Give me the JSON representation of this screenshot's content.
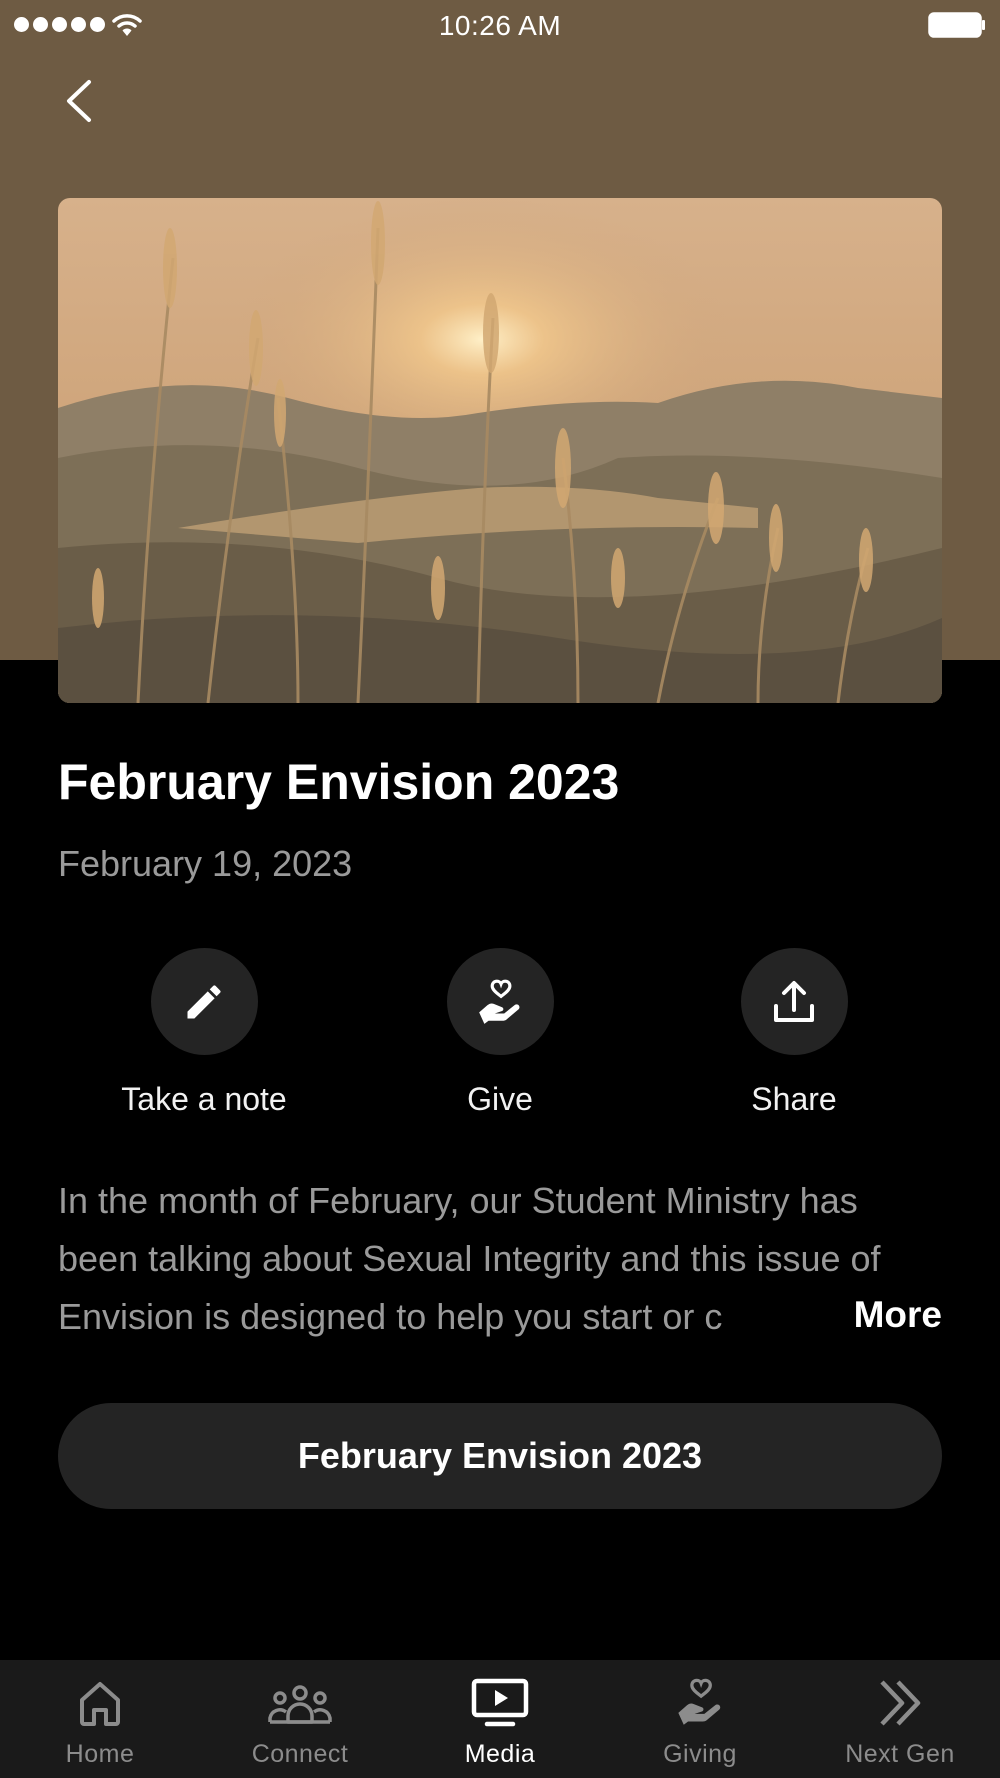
{
  "status_bar": {
    "time": "10:26 AM"
  },
  "content": {
    "title": "February Envision 2023",
    "date": "February 19, 2023",
    "description": "In the month of February, our Student Ministry has been talking about Sexual Integrity and this issue of Envision is designed to help you start or c",
    "more_label": "More",
    "primary_button_label": "February Envision 2023"
  },
  "actions": [
    {
      "label": "Take a note",
      "icon": "pencil-icon"
    },
    {
      "label": "Give",
      "icon": "hand-heart-icon"
    },
    {
      "label": "Share",
      "icon": "share-icon"
    }
  ],
  "tabs": [
    {
      "label": "Home",
      "icon": "home-icon",
      "active": false
    },
    {
      "label": "Connect",
      "icon": "group-icon",
      "active": false
    },
    {
      "label": "Media",
      "icon": "play-screen-icon",
      "active": true
    },
    {
      "label": "Giving",
      "icon": "hand-heart-icon",
      "active": false
    },
    {
      "label": "Next Gen",
      "icon": "double-chevron-icon",
      "active": false
    }
  ],
  "colors": {
    "hero_background": "#6e5b43",
    "page_background": "#000000",
    "surface": "#242424",
    "tab_bar": "#1a1a1a",
    "muted_text": "#9a9a9a"
  }
}
